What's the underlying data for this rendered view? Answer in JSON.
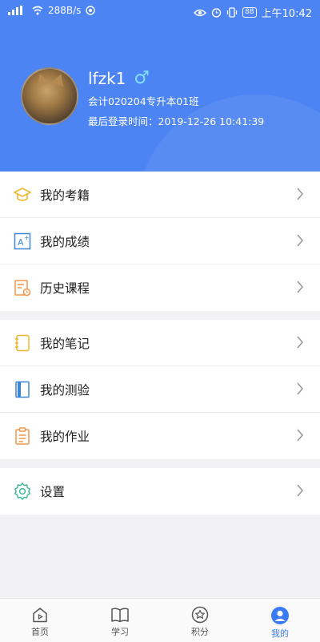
{
  "status_bar": {
    "left_text": "288B/s",
    "right_time": "上午10:42",
    "battery": "88",
    "icons": [
      "signal-icon",
      "wifi-icon",
      "message-icon",
      "eye-icon",
      "alarm-icon",
      "vibrate-icon",
      "battery-icon"
    ]
  },
  "profile": {
    "username": "lfzk1",
    "gender_symbol": "♂",
    "class_name": "会计020204专升本01班",
    "last_login": "最后登录时间：2019-12-26 10:41:39"
  },
  "menu_groups": [
    [
      {
        "label": "我的考籍",
        "icon": "graduation-cap-icon"
      },
      {
        "label": "我的成绩",
        "icon": "grade-icon"
      },
      {
        "label": "历史课程",
        "icon": "history-course-icon"
      }
    ],
    [
      {
        "label": "我的笔记",
        "icon": "notebook-icon"
      },
      {
        "label": "我的测验",
        "icon": "quiz-book-icon"
      },
      {
        "label": "我的作业",
        "icon": "homework-clipboard-icon"
      }
    ],
    [
      {
        "label": "设置",
        "icon": "settings-gear-icon"
      }
    ]
  ],
  "tab_bar": [
    {
      "label": "首页",
      "icon": "home-icon",
      "active": false
    },
    {
      "label": "学习",
      "icon": "book-open-icon",
      "active": false
    },
    {
      "label": "积分",
      "icon": "star-circle-icon",
      "active": false
    },
    {
      "label": "我的",
      "icon": "profile-icon",
      "active": true
    }
  ],
  "colors": {
    "header_bg": "#4c84f3",
    "accent": "#3a7bf5",
    "gender_icon": "#7fe0ff",
    "icon_yellow": "#f2b630",
    "icon_blue": "#3b86d8",
    "icon_orange": "#f0964a",
    "icon_green": "#3cb98c"
  }
}
